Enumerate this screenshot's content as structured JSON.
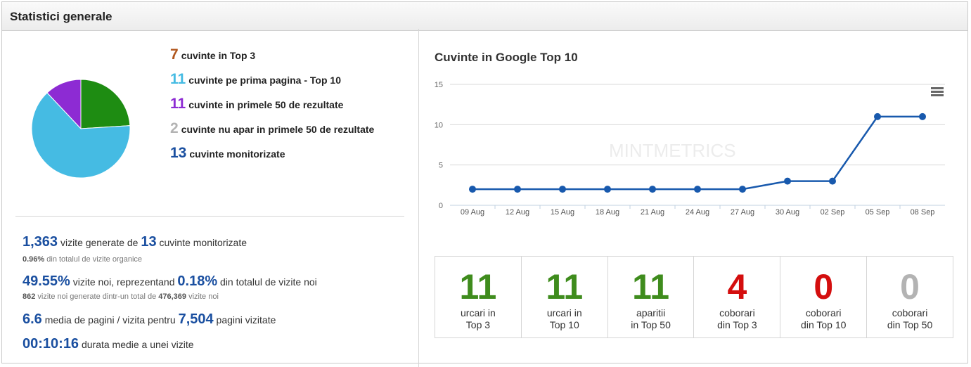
{
  "panel": {
    "title": "Statistici generale"
  },
  "colors": {
    "orange": "#b0561c",
    "cyan": "#45bbe3",
    "purple": "#8d2bd3",
    "gray": "#b3b3b3",
    "blue": "#1a4fa0",
    "green": "#3f8c1d",
    "red": "#d40e0e",
    "pie_green": "#1e8c12",
    "line": "#1859ad"
  },
  "legend": [
    {
      "num": "7",
      "text": "cuvinte in Top 3",
      "color": "#b0561c"
    },
    {
      "num": "11",
      "text": "cuvinte pe prima pagina - Top 10",
      "color": "#45bbe3"
    },
    {
      "num": "11",
      "text": "cuvinte in primele 50 de rezultate",
      "color": "#8d2bd3"
    },
    {
      "num": "2",
      "text": "cuvinte nu apar in primele 50 de rezultate",
      "color": "#b3b3b3"
    },
    {
      "num": "13",
      "text": "cuvinte monitorizate",
      "color": "#1a4fa0"
    }
  ],
  "pie": {
    "slices": [
      {
        "value": 3,
        "color": "#1e8c12"
      },
      {
        "value": 8,
        "color": "#45bbe3"
      },
      {
        "value": 1.5,
        "color": "#8d2bd3"
      }
    ]
  },
  "stats": {
    "visits": {
      "value": "1,363",
      "text": "vizite generate de",
      "keywords": "13",
      "text2": "cuvinte monitorizate"
    },
    "visits_sub": {
      "value": "0.96%",
      "text": "din totalul de vizite organice"
    },
    "new": {
      "value": "49.55%",
      "text": "vizite noi, reprezentand",
      "value2": "0.18%",
      "text2": "din totalul de vizite noi"
    },
    "new_sub": {
      "v1": "862",
      "t1": "vizite noi generate dintr-un total de",
      "v2": "476,369",
      "t2": "vizite noi"
    },
    "pages": {
      "value": "6.6",
      "text": "media de pagini / vizita pentru",
      "value2": "7,504",
      "text2": "pagini vizitate"
    },
    "duration": {
      "value": "00:10:16",
      "text": "durata medie a unei vizite"
    }
  },
  "chart_data": {
    "type": "line",
    "title": "Cuvinte in Google Top 10",
    "categories": [
      "09 Aug",
      "12 Aug",
      "15 Aug",
      "18 Aug",
      "21 Aug",
      "24 Aug",
      "27 Aug",
      "30 Aug",
      "02 Sep",
      "05 Sep",
      "08 Sep"
    ],
    "series": [
      {
        "values": [
          2,
          2,
          2,
          2,
          2,
          2,
          2,
          3,
          3,
          11,
          11
        ]
      }
    ],
    "yticks": [
      0,
      5,
      10,
      15
    ],
    "ylim": [
      0,
      15
    ],
    "grid": true,
    "watermark": "MINTMETRICS"
  },
  "counts": [
    {
      "value": "11",
      "line1": "urcari in",
      "line2": "Top 3",
      "color": "#3f8c1d"
    },
    {
      "value": "11",
      "line1": "urcari in",
      "line2": "Top 10",
      "color": "#3f8c1d"
    },
    {
      "value": "11",
      "line1": "aparitii",
      "line2": "in Top 50",
      "color": "#3f8c1d"
    },
    {
      "value": "4",
      "line1": "coborari",
      "line2": "din Top 3",
      "color": "#d40e0e"
    },
    {
      "value": "0",
      "line1": "coborari",
      "line2": "din Top 10",
      "color": "#d40e0e"
    },
    {
      "value": "0",
      "line1": "coborari",
      "line2": "din Top 50",
      "color": "#b3b3b3"
    }
  ]
}
